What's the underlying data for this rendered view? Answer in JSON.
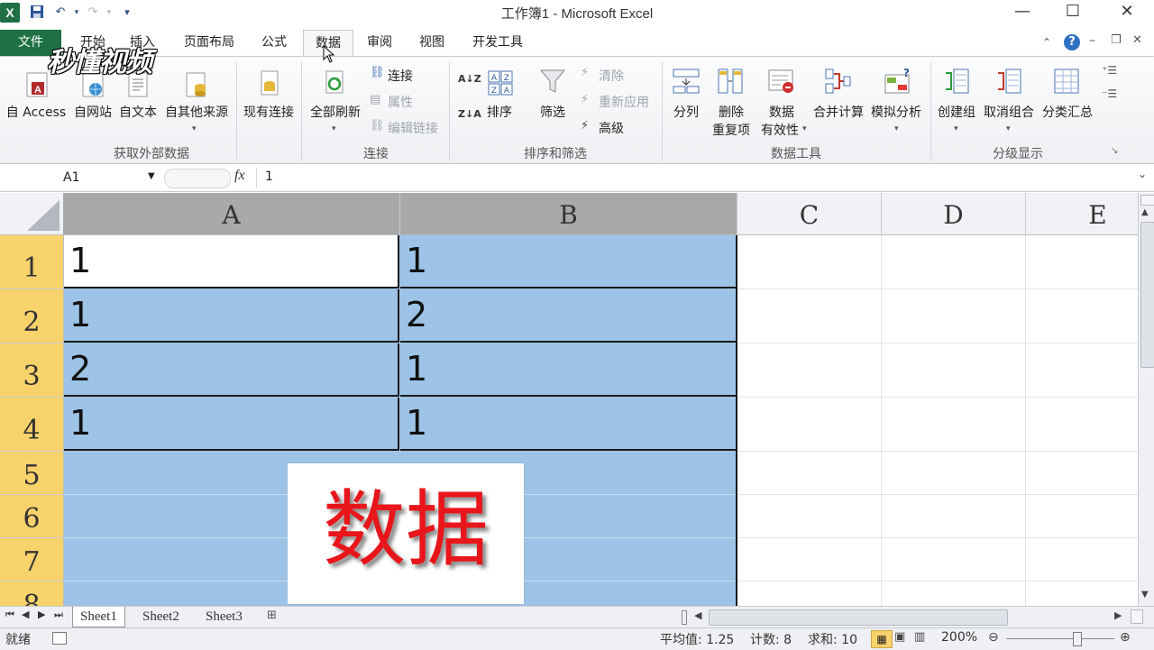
{
  "window": {
    "title": "工作簿1 - Microsoft Excel",
    "app_icon_letter": "X",
    "minimize": "—",
    "maximize": "☐",
    "close": "✕"
  },
  "tabs": {
    "file": "文件",
    "items": [
      "开始",
      "插入",
      "页面布局",
      "公式",
      "数据",
      "审阅",
      "视图",
      "开发工具"
    ],
    "active": "数据"
  },
  "watermark": {
    "text": "秒懂视频"
  },
  "ribbon": {
    "group_external": {
      "label": "获取外部数据",
      "buttons": [
        "自 Access",
        "自网站",
        "自文本",
        "自其他来源",
        "现有连接"
      ]
    },
    "group_connections": {
      "label": "连接",
      "refresh_all": "全部刷新",
      "connections": "连接",
      "properties": "属性",
      "edit_links": "编辑链接"
    },
    "group_sort": {
      "label": "排序和筛选",
      "sort": "排序",
      "filter": "筛选",
      "clear": "清除",
      "reapply": "重新应用",
      "advanced": "高级",
      "az": "A↓Z",
      "za": "Z↓A"
    },
    "group_tools": {
      "label": "数据工具",
      "text_to_columns": "分列",
      "remove_dup_1": "删除",
      "remove_dup_2": "重复项",
      "validation_1": "数据",
      "validation_2": "有效性",
      "consolidate": "合并计算",
      "whatif": "模拟分析"
    },
    "group_outline": {
      "label": "分级显示",
      "group": "创建组",
      "ungroup": "取消组合",
      "subtotal": "分类汇总"
    }
  },
  "formula_bar": {
    "name_box": "A1",
    "fx": "fx",
    "value": "1"
  },
  "grid": {
    "columns": [
      "A",
      "B",
      "C",
      "D",
      "E"
    ],
    "rows": [
      "1",
      "2",
      "3",
      "4",
      "5",
      "6",
      "7",
      "8"
    ],
    "cells": [
      [
        "1",
        "1"
      ],
      [
        "1",
        "2"
      ],
      [
        "2",
        "1"
      ],
      [
        "1",
        "1"
      ]
    ]
  },
  "overlay": {
    "text": "数据"
  },
  "sheets": [
    "Sheet1",
    "Sheet2",
    "Sheet3"
  ],
  "status": {
    "mode": "就绪",
    "average": "平均值: 1.25",
    "count": "计数: 8",
    "sum": "求和: 10",
    "zoom": "200%"
  },
  "colors": {
    "excel_green": "#1f7145",
    "selection_blue": "#9dc3e6",
    "row_header_selected": "#f8d26a",
    "overlay_red": "#e8151b"
  }
}
